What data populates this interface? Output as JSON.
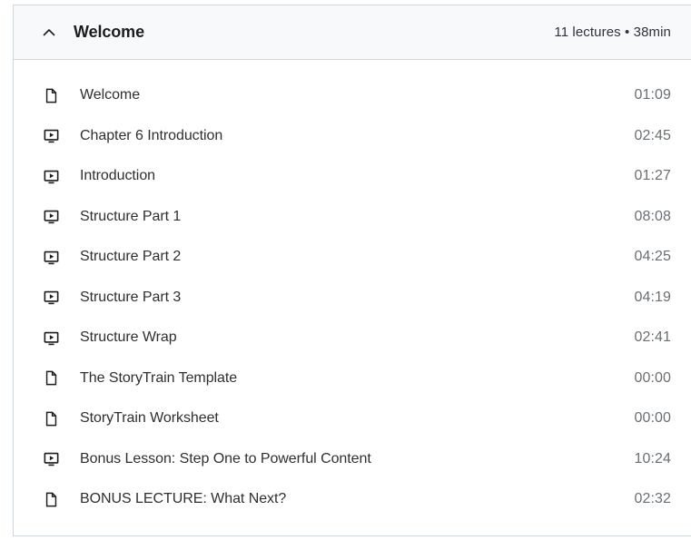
{
  "section": {
    "title": "Welcome",
    "meta": "11 lectures • 38min",
    "collapse_icon": "chevron-up-icon",
    "expanded": true
  },
  "colors": {
    "header_bg": "#f7f9fa",
    "border": "#d1d7dc",
    "title_text": "#1c1d1f",
    "row_text": "#2d2f31",
    "duration_text": "#6a6f73",
    "body_bg": "#ffffff"
  },
  "lectures": [
    {
      "icon": "document-icon",
      "title": "Welcome",
      "duration": "01:09"
    },
    {
      "icon": "video-icon",
      "title": "Chapter 6 Introduction",
      "duration": "02:45"
    },
    {
      "icon": "video-icon",
      "title": "Introduction",
      "duration": "01:27"
    },
    {
      "icon": "video-icon",
      "title": "Structure Part 1",
      "duration": "08:08"
    },
    {
      "icon": "video-icon",
      "title": "Structure Part 2",
      "duration": "04:25"
    },
    {
      "icon": "video-icon",
      "title": "Structure Part 3",
      "duration": "04:19"
    },
    {
      "icon": "video-icon",
      "title": "Structure Wrap",
      "duration": "02:41"
    },
    {
      "icon": "document-icon",
      "title": "The StoryTrain Template",
      "duration": "00:00"
    },
    {
      "icon": "document-icon",
      "title": "StoryTrain Worksheet",
      "duration": "00:00"
    },
    {
      "icon": "video-icon",
      "title": "Bonus Lesson: Step One to Powerful Content",
      "duration": "10:24"
    },
    {
      "icon": "document-icon",
      "title": "BONUS LECTURE: What Next?",
      "duration": "02:32"
    }
  ]
}
